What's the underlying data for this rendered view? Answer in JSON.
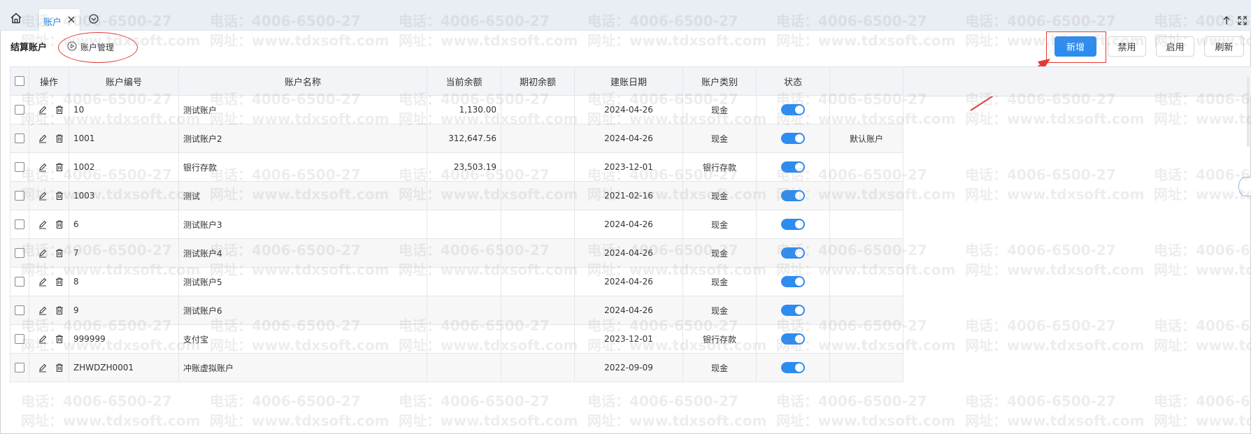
{
  "tabbar": {
    "tab_label": "账户"
  },
  "toolbar": {
    "title": "结算账户",
    "mgmt_label": "账户管理",
    "add_label": "新增",
    "disable_label": "禁用",
    "enable_label": "启用",
    "refresh_label": "刷新"
  },
  "table": {
    "headers": [
      "操作",
      "账户编号",
      "账户名称",
      "当前余额",
      "期初余额",
      "建账日期",
      "账户类别",
      "状态"
    ],
    "rows": [
      {
        "code": "10",
        "name": "测试账户",
        "balance": "1,130.00",
        "opening": "",
        "date": "2024-04-26",
        "type": "现金",
        "enabled": true,
        "note": ""
      },
      {
        "code": "1001",
        "name": "测试账户2",
        "balance": "312,647.56",
        "opening": "",
        "date": "2024-04-26",
        "type": "现金",
        "enabled": true,
        "note": "默认账户"
      },
      {
        "code": "1002",
        "name": "银行存款",
        "balance": "23,503.19",
        "opening": "",
        "date": "2023-12-01",
        "type": "银行存款",
        "enabled": true,
        "note": ""
      },
      {
        "code": "1003",
        "name": "测试",
        "balance": "",
        "opening": "",
        "date": "2021-02-16",
        "type": "现金",
        "enabled": true,
        "note": ""
      },
      {
        "code": "6",
        "name": "测试账户3",
        "balance": "",
        "opening": "",
        "date": "2024-04-26",
        "type": "现金",
        "enabled": true,
        "note": ""
      },
      {
        "code": "7",
        "name": "测试账户4",
        "balance": "",
        "opening": "",
        "date": "2024-04-26",
        "type": "现金",
        "enabled": true,
        "note": ""
      },
      {
        "code": "8",
        "name": "测试账户5",
        "balance": "",
        "opening": "",
        "date": "2024-04-26",
        "type": "现金",
        "enabled": true,
        "note": ""
      },
      {
        "code": "9",
        "name": "测试账户6",
        "balance": "",
        "opening": "",
        "date": "2024-04-26",
        "type": "现金",
        "enabled": true,
        "note": ""
      },
      {
        "code": "999999",
        "name": "支付宝",
        "balance": "",
        "opening": "",
        "date": "2023-12-01",
        "type": "银行存款",
        "enabled": true,
        "note": ""
      },
      {
        "code": "ZHWDZH0001",
        "name": "冲账虚拟账户",
        "balance": "",
        "opening": "",
        "date": "2022-09-09",
        "type": "现金",
        "enabled": true,
        "note": ""
      }
    ]
  },
  "watermark": {
    "phone": "电话：4006-6500-27",
    "site": "网址：www.tdxsoft.com"
  },
  "colors": {
    "accent": "#2d8cf0",
    "annotation": "#e53935"
  }
}
